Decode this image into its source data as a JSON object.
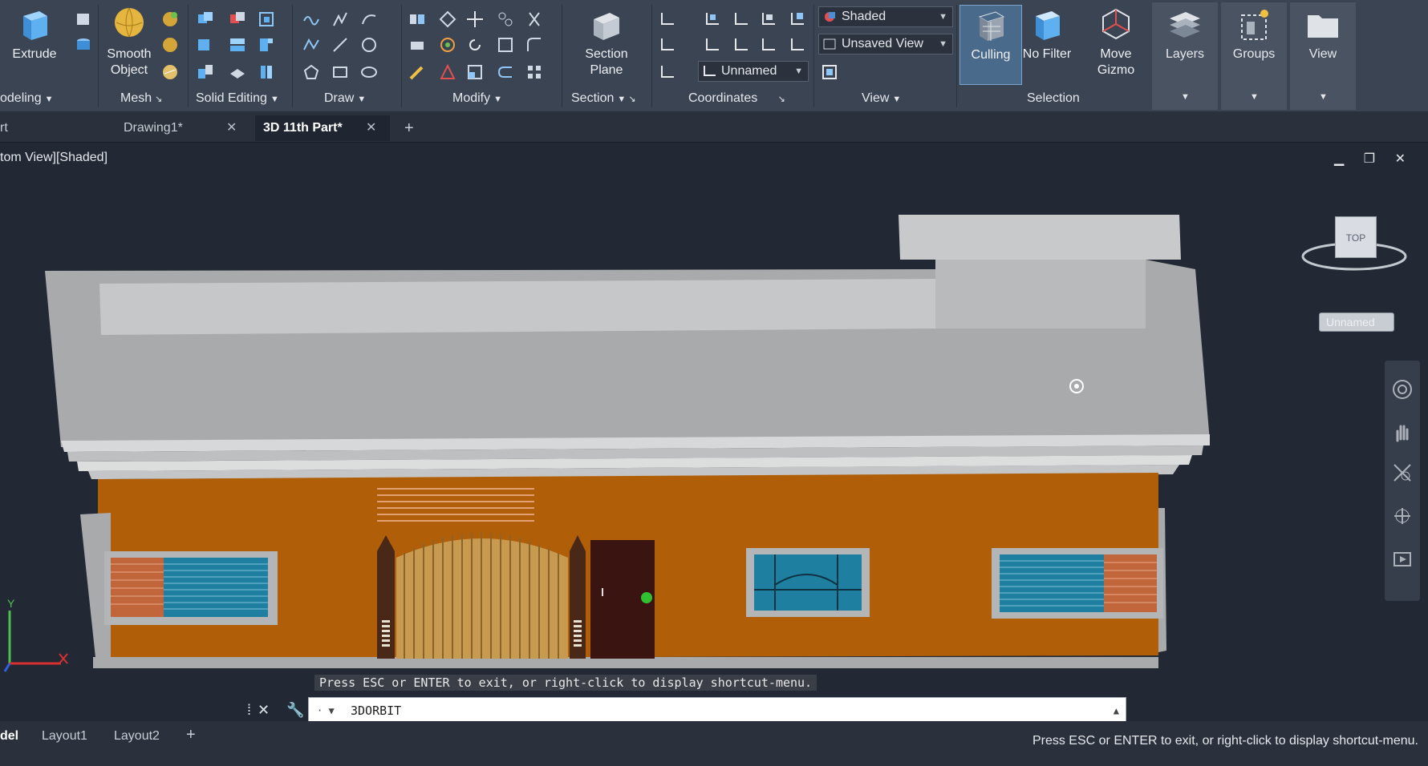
{
  "ribbon": {
    "modeling": {
      "extrude": "Extrude",
      "label": "odeling"
    },
    "mesh": {
      "smooth_object": "Smooth\nObject",
      "label": "Mesh"
    },
    "solid_editing": {
      "label": "Solid Editing"
    },
    "draw": {
      "label": "Draw"
    },
    "modify": {
      "label": "Modify"
    },
    "section": {
      "section_plane": "Section\nPlane",
      "label": "Section"
    },
    "coordinates": {
      "label": "Coordinates",
      "ucs_combo": "Unnamed"
    },
    "view": {
      "visual_style": "Shaded",
      "named_view": "Unsaved View",
      "label": "View"
    },
    "selection": {
      "culling": "Culling",
      "no_filter": "No Filter",
      "move_gizmo": "Move\nGizmo",
      "label": "Selection"
    },
    "layers": "Layers",
    "groups": "Groups",
    "view_btn": "View"
  },
  "tabs": {
    "partial": "rt",
    "drawing1": "Drawing1*",
    "part": "3D 11th Part*",
    "close_glyph": "✕",
    "add_glyph": "+"
  },
  "viewport": {
    "label": "tom View][Shaded]",
    "controls": "▁ ❐ ✕",
    "hint": "Press ESC or ENTER to exit, or right-click to display shortcut-menu.",
    "viewcube_top": "TOP",
    "viewcube_unnamed": "Unnamed"
  },
  "command_line": {
    "value": "3DORBIT",
    "tools": "✕ 🔧"
  },
  "layout_tabs": {
    "model": "del",
    "layout1": "Layout1",
    "layout2": "Layout2",
    "add": "+"
  },
  "status": {
    "message": "Press ESC or ENTER to exit, or right-click to display shortcut-menu."
  },
  "colors": {
    "ribbon_bg": "#3b4453",
    "wall": "#b05e08",
    "roof": "#a9aaab",
    "window_glass": "#1f7fa0"
  }
}
